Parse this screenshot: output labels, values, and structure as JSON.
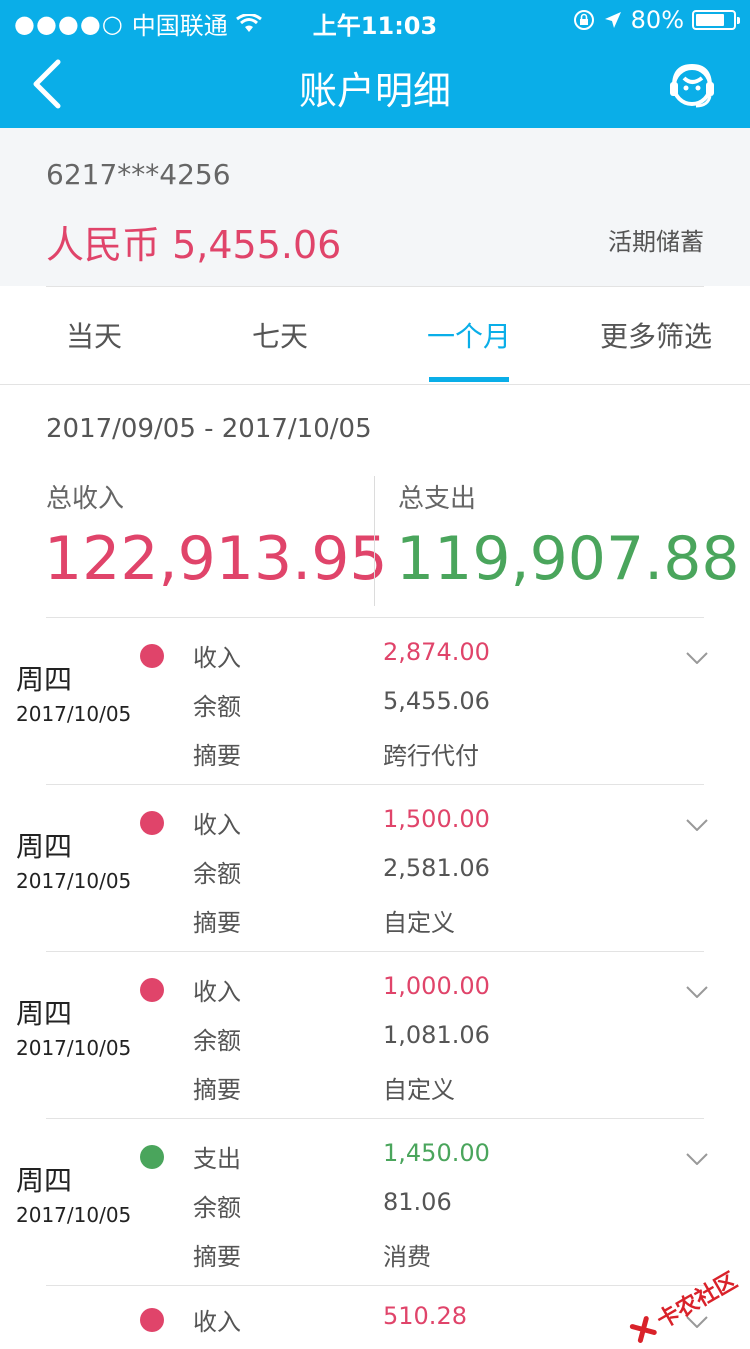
{
  "status": {
    "signal_dots": "●●●●○",
    "carrier": "中国联通",
    "time": "上午11:03",
    "battery": "80%",
    "battery_level": 0.8
  },
  "nav": {
    "title": "账户明细",
    "back_icon": "chevron-left-icon",
    "service_icon": "customer-service-icon"
  },
  "account": {
    "number": "6217***4256",
    "balance": "人民币 5,455.06",
    "type": "活期储蓄"
  },
  "tabs": [
    "当天",
    "七天",
    "一个月",
    "更多筛选"
  ],
  "active_tab": 2,
  "summary": {
    "range": "2017/09/05 - 2017/10/05",
    "income_label": "总收入",
    "income": "122,913.95",
    "expense_label": "总支出",
    "expense": "119,907.88"
  },
  "colors": {
    "primary": "#0aaee8",
    "income": "#e0446a",
    "expense": "#4aa55c"
  },
  "transactions": [
    {
      "day": "周四",
      "date": "2017/10/05",
      "type": "收入",
      "amount": "2,874.00",
      "balance_label": "余额",
      "balance": "5,455.06",
      "memo_label": "摘要",
      "memo": "跨行代付",
      "kind": "income"
    },
    {
      "day": "周四",
      "date": "2017/10/05",
      "type": "收入",
      "amount": "1,500.00",
      "balance_label": "余额",
      "balance": "2,581.06",
      "memo_label": "摘要",
      "memo": "自定义",
      "kind": "income"
    },
    {
      "day": "周四",
      "date": "2017/10/05",
      "type": "收入",
      "amount": "1,000.00",
      "balance_label": "余额",
      "balance": "1,081.06",
      "memo_label": "摘要",
      "memo": "自定义",
      "kind": "income"
    },
    {
      "day": "周四",
      "date": "2017/10/05",
      "type": "支出",
      "amount": "1,450.00",
      "balance_label": "余额",
      "balance": "81.06",
      "memo_label": "摘要",
      "memo": "消费",
      "kind": "expense"
    },
    {
      "day": "",
      "date": "",
      "type": "收入",
      "amount": "510.28",
      "balance_label": "",
      "balance": "",
      "memo_label": "",
      "memo": "",
      "kind": "income"
    }
  ],
  "watermark": "卡农社区"
}
